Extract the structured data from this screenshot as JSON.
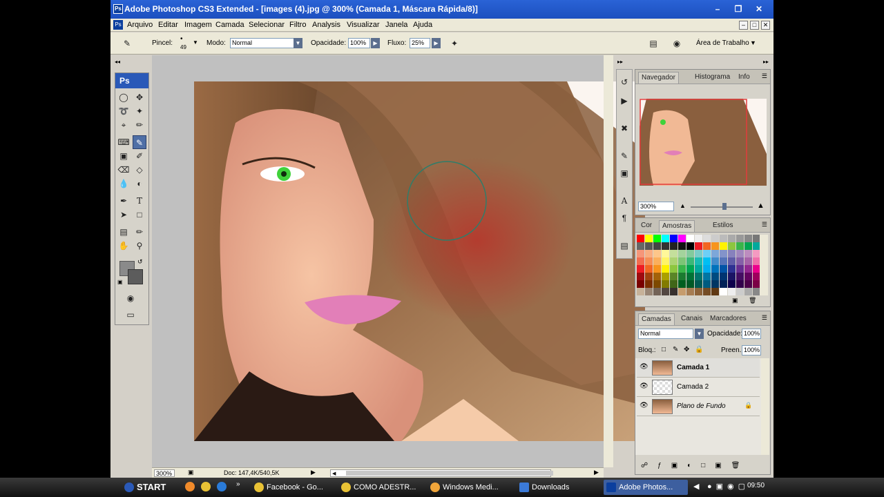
{
  "window": {
    "title": "Adobe Photoshop CS3 Extended - [images (4).jpg @ 300% (Camada 1, Máscara Rápida/8)]",
    "app_icon": "Ps"
  },
  "menu": [
    "Arquivo",
    "Editar",
    "Imagem",
    "Camada",
    "Selecionar",
    "Filtro",
    "Analysis",
    "Visualizar",
    "Janela",
    "Ajuda"
  ],
  "options": {
    "brush_label": "Pincel:",
    "brush_size": "49",
    "mode_label": "Modo:",
    "mode_value": "Normal",
    "opacity_label": "Opacidade:",
    "opacity_value": "100%",
    "flow_label": "Fluxo:",
    "flow_value": "25%",
    "workspace": "Área de Trabalho"
  },
  "toolbox": {
    "header": "Ps"
  },
  "navigator": {
    "tabs": [
      "Navegador",
      "Histograma",
      "Info"
    ],
    "zoom": "300%"
  },
  "swatches": {
    "tabs": [
      "Cor",
      "Amostras",
      "Estilos"
    ]
  },
  "layers": {
    "tabs": [
      "Camadas",
      "Canais",
      "Marcadores"
    ],
    "blend_mode": "Normal",
    "opacity_label": "Opacidade:",
    "opacity_value": "100%",
    "lock_label": "Bloq.:",
    "fill_label": "Preen.:",
    "fill_value": "100%",
    "items": [
      {
        "name": "Camada 1"
      },
      {
        "name": "Camada 2"
      },
      {
        "name": "Plano de Fundo"
      }
    ]
  },
  "status": {
    "zoom": "300%",
    "doc": "Doc: 147,4K/540,5K"
  },
  "taskbar": {
    "start": "START",
    "tasks": [
      "Facebook - Go...",
      "COMO ADESTR...",
      "Windows Medi...",
      "Downloads",
      "Adobe Photos..."
    ],
    "clock": "09:50"
  },
  "colors": {
    "title_bar": "#1c4fbf",
    "chrome": "#ece9d8",
    "panel": "#d6d3ca",
    "selected_tool": "#4f6fa6",
    "eye_green": "#3fd23a",
    "hair_red": "#b8342a"
  }
}
